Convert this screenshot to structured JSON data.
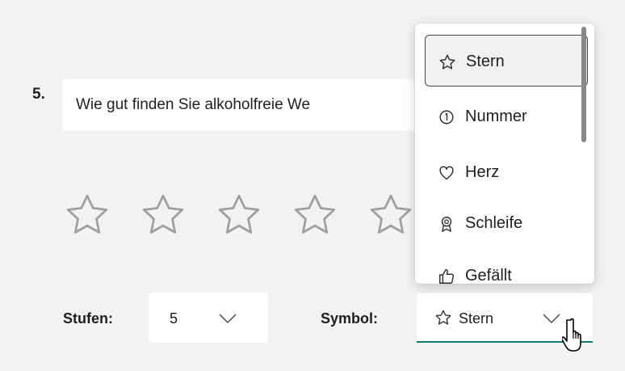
{
  "question": {
    "number": "5.",
    "text": "Wie gut finden Sie alkoholfreie We"
  },
  "rating": {
    "level_count": 5,
    "star_outline_color": "#a19f9d",
    "icon": "star-outline-icon"
  },
  "settings": {
    "levels_label": "Stufen:",
    "levels_value": "5",
    "symbol_label": "Symbol:",
    "symbol_value": "Stern",
    "accent_color": "#0b7b74"
  },
  "dropdown": {
    "options": [
      {
        "label": "Stern",
        "icon": "star-icon",
        "selected": true
      },
      {
        "label": "Nummer",
        "icon": "number-icon",
        "selected": false
      },
      {
        "label": "Herz",
        "icon": "heart-icon",
        "selected": false
      },
      {
        "label": "Schleife",
        "icon": "ribbon-icon",
        "selected": false
      },
      {
        "label": "Gefällt",
        "icon": "thumbs-up-icon",
        "selected": false
      }
    ]
  }
}
